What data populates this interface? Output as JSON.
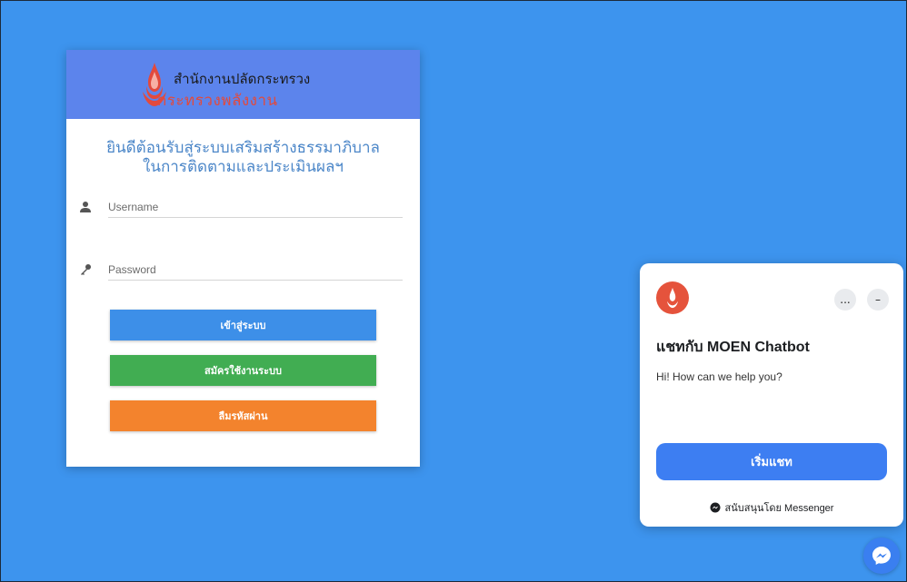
{
  "login": {
    "org_name": "สำนักงานปลัดกระทรวง",
    "org_ministry": "กระทรวงพลังงาน",
    "welcome_line1": "ยินดีต้อนรับสู่ระบบเสริมสร้างธรรมาภิบาล",
    "welcome_line2": "ในการติดตามและประเมินผลฯ",
    "username_placeholder": "Username",
    "password_placeholder": "Password",
    "login_label": "เข้าสู่ระบบ",
    "register_label": "สมัครใช้งานระบบ",
    "forgot_label": "ลืมรหัสผ่าน",
    "header_color": "#5c84ec",
    "login_color": "#3d8fe8",
    "register_color": "#41ad52",
    "forgot_color": "#f3832d"
  },
  "chat": {
    "title": "แชทกับ MOEN Chatbot",
    "greeting": "Hi! How can we help you?",
    "more_label": "...",
    "minimize_label": "–",
    "start_label": "เริ่มแชท",
    "powered_by": "สนับสนุนโดย Messenger",
    "accent_color": "#3d7ef2"
  },
  "icons": {
    "user": "user-icon",
    "key": "key-icon",
    "messenger": "messenger-icon",
    "logo": "ministry-logo-icon"
  }
}
